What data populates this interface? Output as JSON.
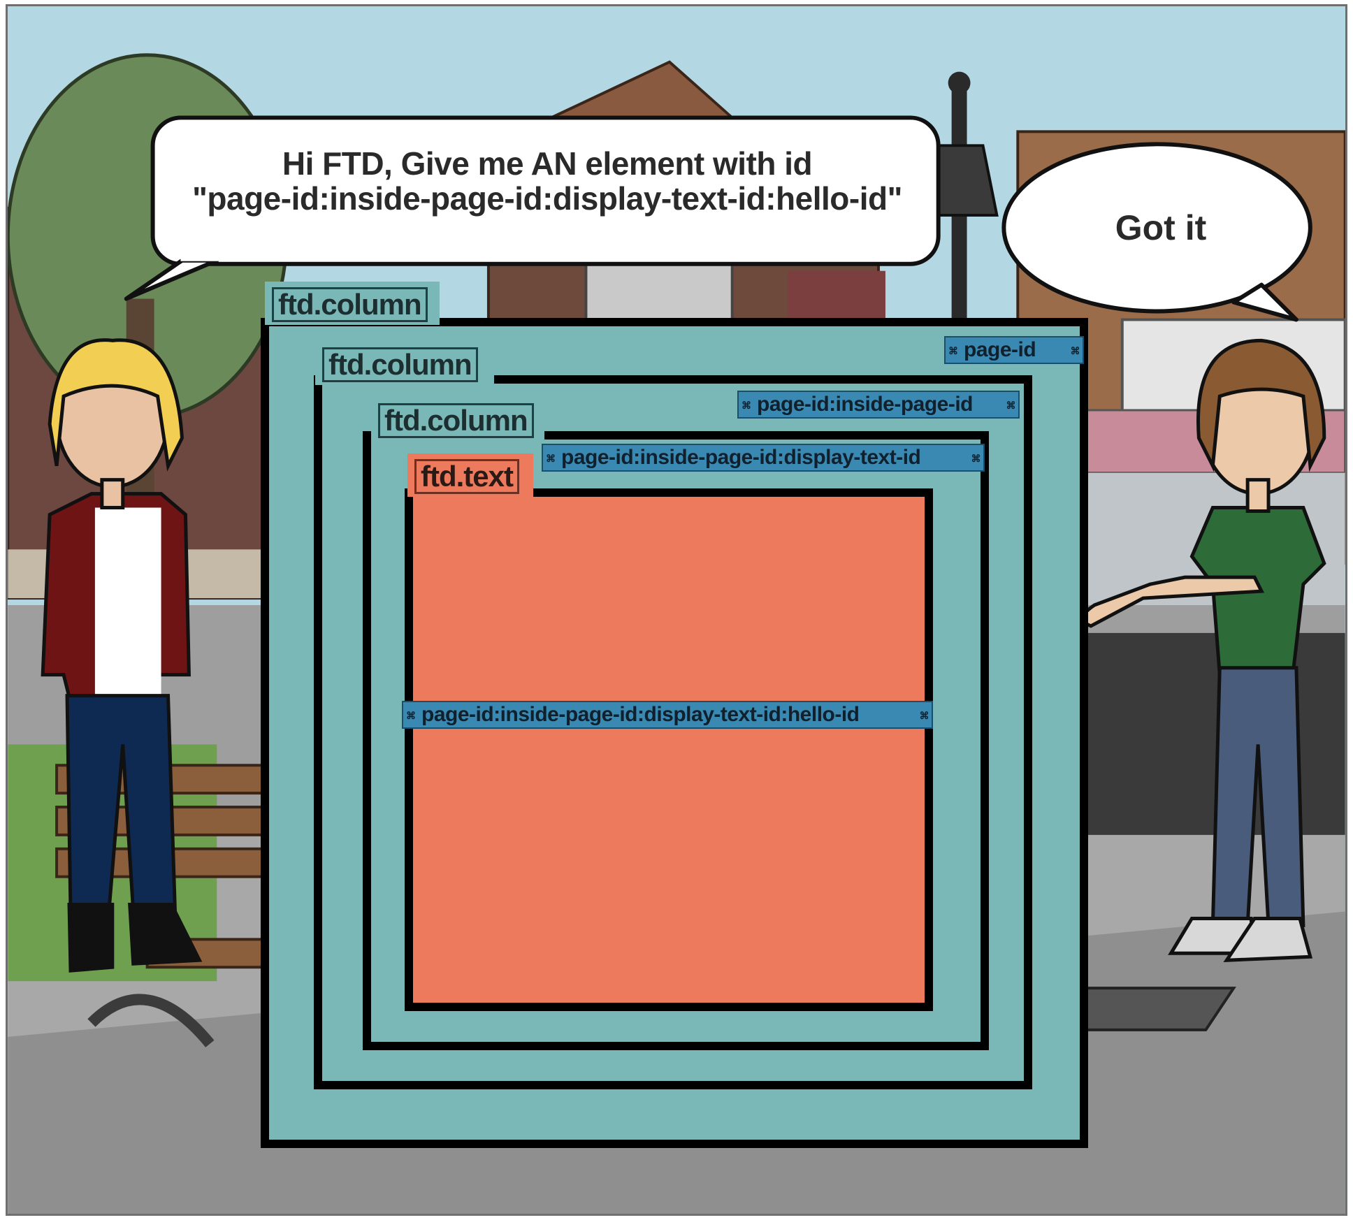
{
  "speech": {
    "left_line1": "Hi FTD, Give me AN element with id",
    "left_line2": "\"page-id:inside-page-id:display-text-id:hello-id\"",
    "right": "Got it"
  },
  "labels": {
    "column_outer": "ftd.column",
    "column_middle": "ftd.column",
    "column_inner": "ftd.column",
    "text": "ftd.text"
  },
  "ids": {
    "page": "page-id",
    "inside_page": "page-id:inside-page-id",
    "display_text": "page-id:inside-page-id:display-text-id",
    "hello": "page-id:inside-page-id:display-text-id:hello-id"
  },
  "colors": {
    "column_fill": "#7ab8b7",
    "text_fill": "#ed7a5c",
    "id_tag": "#3a89b3",
    "border": "#000000"
  },
  "icons": {
    "tag_ornament": "scroll-ornament-icon"
  }
}
